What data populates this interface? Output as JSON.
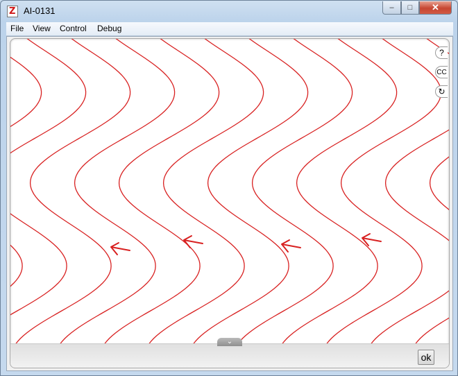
{
  "window": {
    "title": "AI-0131",
    "minimize_glyph": "–",
    "maximize_glyph": "□",
    "close_glyph": "✕"
  },
  "menu": [
    "File",
    "View",
    "Control",
    "Debug"
  ],
  "side_controls": [
    {
      "label": "?",
      "icon": "help-icon"
    },
    {
      "label": "CC",
      "icon": "captions-icon"
    },
    {
      "label": "↻",
      "icon": "refresh-icon"
    }
  ],
  "collapse_glyph": "⌄",
  "ok_label": "ok",
  "colors": {
    "curve": "#d82020",
    "arrow": "#d82020"
  }
}
